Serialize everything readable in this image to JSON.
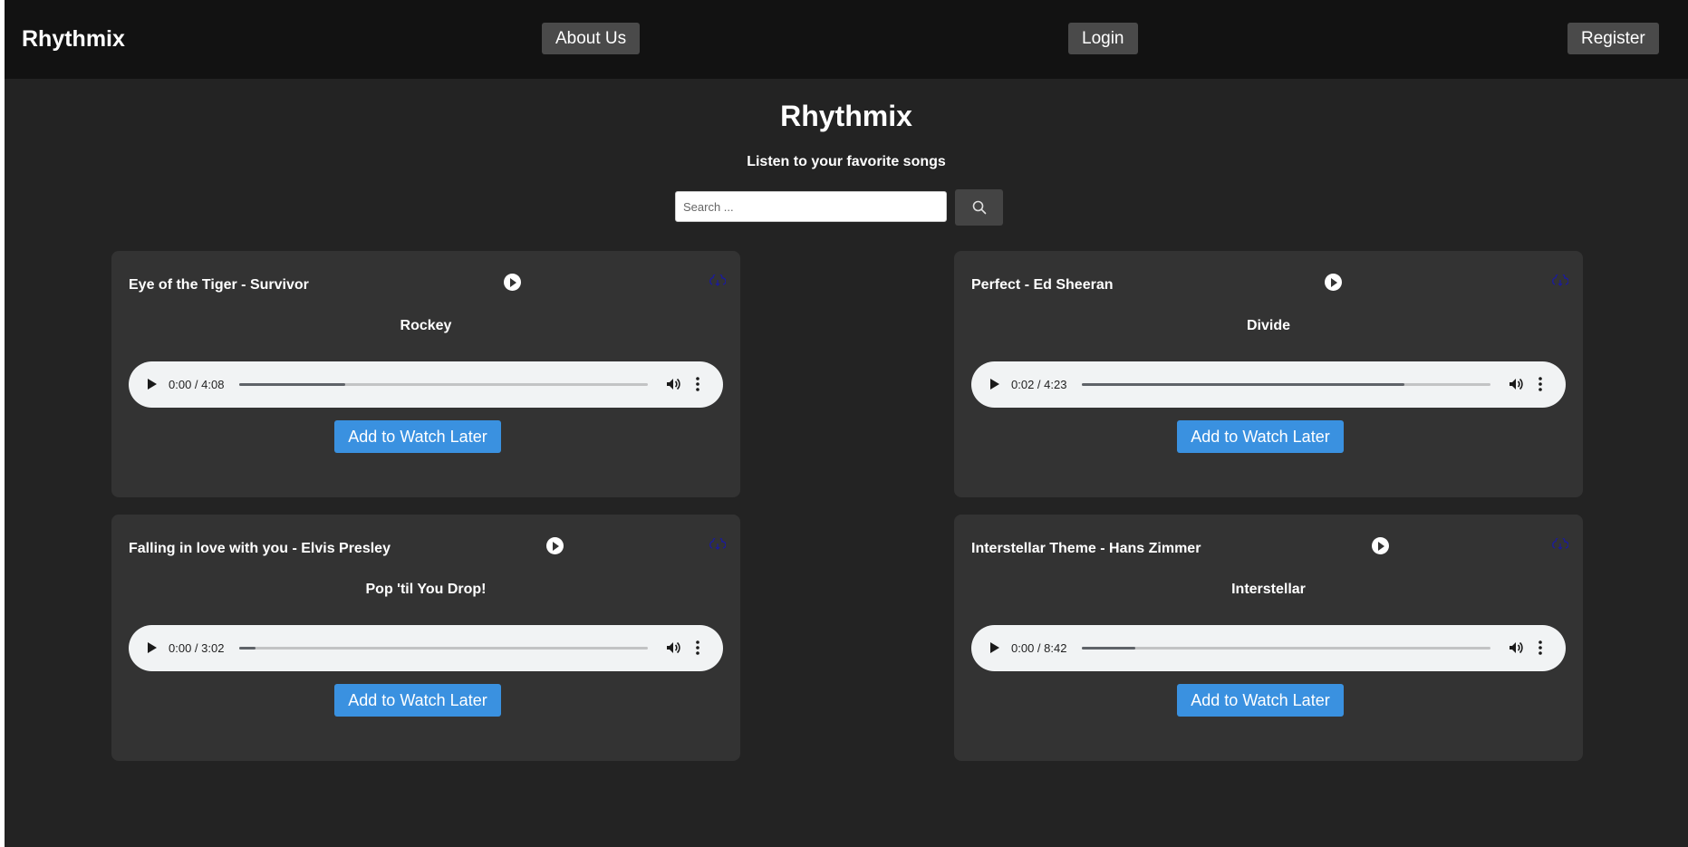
{
  "navbar": {
    "brand": "Rhythmix",
    "about_label": "About Us",
    "login_label": "Login",
    "register_label": "Register"
  },
  "hero": {
    "title": "Rhythmix",
    "subtitle": "Listen to your favorite songs"
  },
  "search": {
    "placeholder": "Search ...",
    "value": "",
    "icon": "search-icon"
  },
  "songs": [
    {
      "title": "Eye of the Tiger - Survivor",
      "album": "Rockey",
      "time": "0:00 / 4:08",
      "buffered_percent": 26,
      "progress_percent": 0,
      "watch_later_label": "Add to Watch Later"
    },
    {
      "title": "Perfect - Ed Sheeran",
      "album": "Divide",
      "time": "0:02 / 4:23",
      "buffered_percent": 79,
      "progress_percent": 1,
      "watch_later_label": "Add to Watch Later"
    },
    {
      "title": "Falling in love with you - Elvis Presley",
      "album": "Pop 'til You Drop!",
      "time": "0:00 / 3:02",
      "buffered_percent": 4,
      "progress_percent": 0,
      "watch_later_label": "Add to Watch Later"
    },
    {
      "title": "Interstellar Theme - Hans Zimmer",
      "album": "Interstellar",
      "time": "0:00 / 8:42",
      "buffered_percent": 13,
      "progress_percent": 0,
      "watch_later_label": "Add to Watch Later"
    }
  ],
  "colors": {
    "background": "#232323",
    "navbar": "#121212",
    "card": "#333333",
    "accent": "#3a91e0",
    "download_icon": "#1a1aa0"
  }
}
